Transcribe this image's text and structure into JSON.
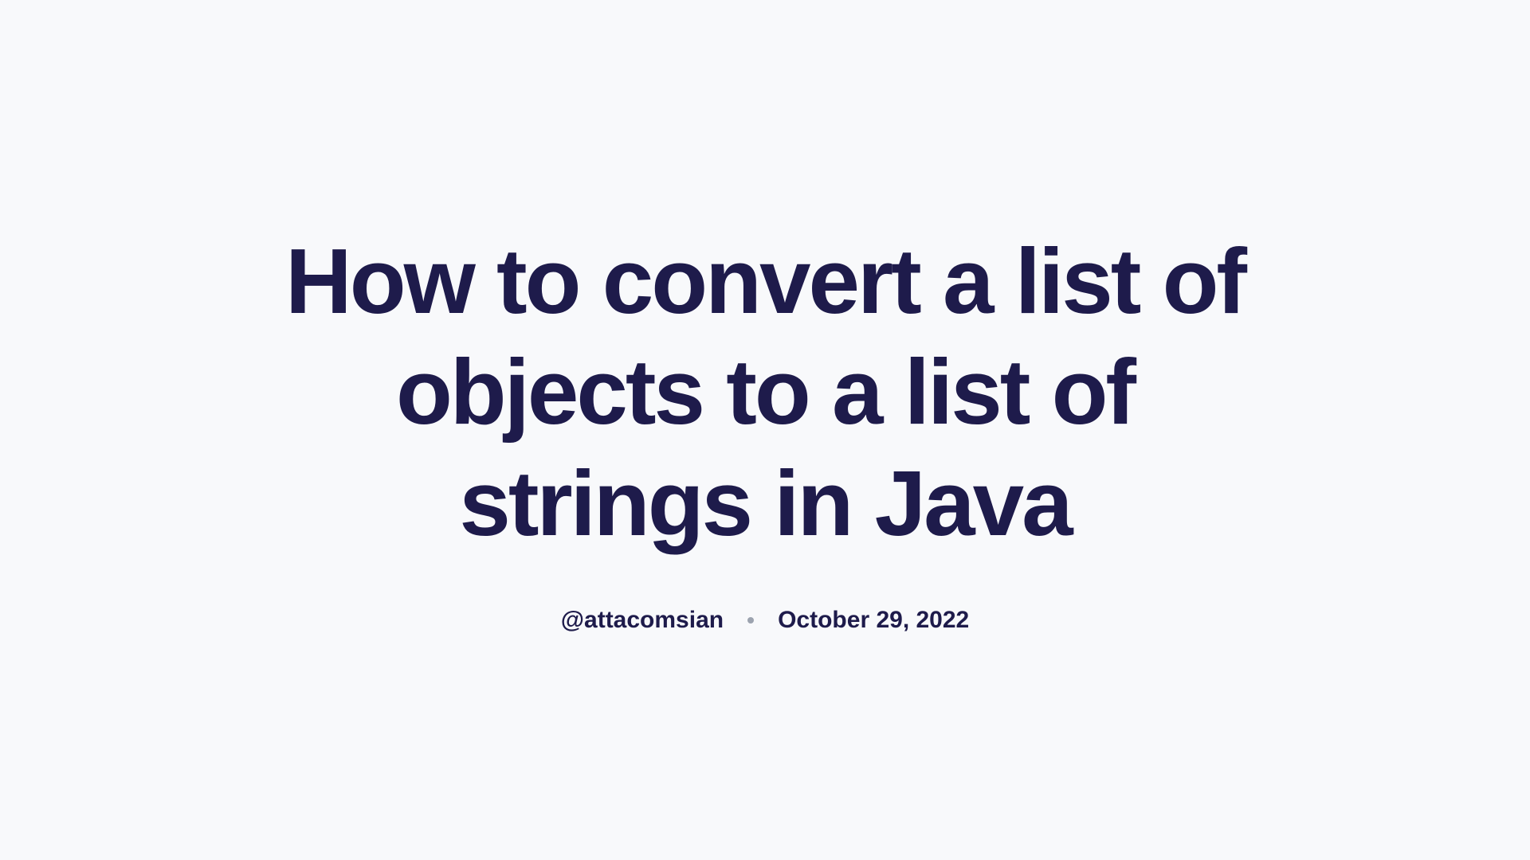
{
  "title": "How to convert a list of objects to a list of strings in Java",
  "author": "@attacomsian",
  "date": "October 29, 2022"
}
